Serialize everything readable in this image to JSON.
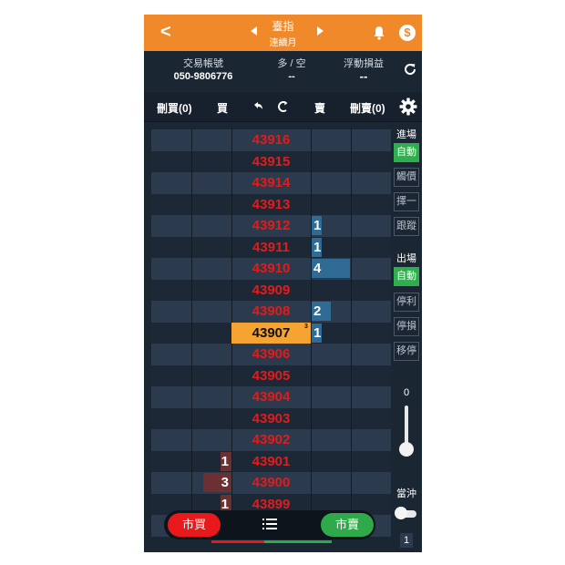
{
  "header": {
    "title": "臺指",
    "subtitle": "連續月",
    "back_glyph": "<",
    "coin_glyph": "$"
  },
  "account": {
    "account_label": "交易帳號",
    "account_value": "050-9806776",
    "position_label": "多 / 空",
    "position_value": "--",
    "pnl_label": "浮動損益",
    "pnl_value": "--"
  },
  "toolbar": {
    "delete_buy": "刪買(0)",
    "buy": "買",
    "sell": "賣",
    "delete_sell": "刪賣(0)"
  },
  "ladder": {
    "current_price": "43907",
    "current_marker": "3",
    "rows": [
      {
        "price": "43916",
        "buy": "",
        "sell": ""
      },
      {
        "price": "43915",
        "buy": "",
        "sell": ""
      },
      {
        "price": "43914",
        "buy": "",
        "sell": ""
      },
      {
        "price": "43913",
        "buy": "",
        "sell": ""
      },
      {
        "price": "43912",
        "buy": "",
        "sell": "1"
      },
      {
        "price": "43911",
        "buy": "",
        "sell": "1"
      },
      {
        "price": "43910",
        "buy": "",
        "sell": "4"
      },
      {
        "price": "43909",
        "buy": "",
        "sell": ""
      },
      {
        "price": "43908",
        "buy": "",
        "sell": "2"
      },
      {
        "price": "43907",
        "buy": "",
        "sell": "1"
      },
      {
        "price": "43906",
        "buy": "",
        "sell": ""
      },
      {
        "price": "43905",
        "buy": "",
        "sell": ""
      },
      {
        "price": "43904",
        "buy": "",
        "sell": ""
      },
      {
        "price": "43903",
        "buy": "",
        "sell": ""
      },
      {
        "price": "43902",
        "buy": "",
        "sell": ""
      },
      {
        "price": "43901",
        "buy": "1",
        "sell": ""
      },
      {
        "price": "43900",
        "buy": "3",
        "sell": ""
      },
      {
        "price": "43899",
        "buy": "1",
        "sell": ""
      },
      {
        "price": "43898",
        "buy": "",
        "sell": ""
      }
    ]
  },
  "right_panel": {
    "entry_label": "進場",
    "entry_auto": "自動",
    "touch_price": "觸價",
    "pick_one": "擇一",
    "trailing": "跟蹤",
    "exit_label": "出場",
    "exit_auto": "自動",
    "take_profit": "停利",
    "stop_loss": "停損",
    "move_stop": "移停",
    "slider_value": "0",
    "day_trade_label": "當沖",
    "quantity": "1"
  },
  "bottom": {
    "market_buy": "市買",
    "market_sell": "市賣"
  },
  "colors": {
    "header": "#f0892a",
    "price_red": "#e21b1b",
    "current_price_bg": "#f5a431",
    "sell_bar": "#2f6b94",
    "buy_bar": "#6c3033",
    "auto_green": "#2fae4e"
  }
}
